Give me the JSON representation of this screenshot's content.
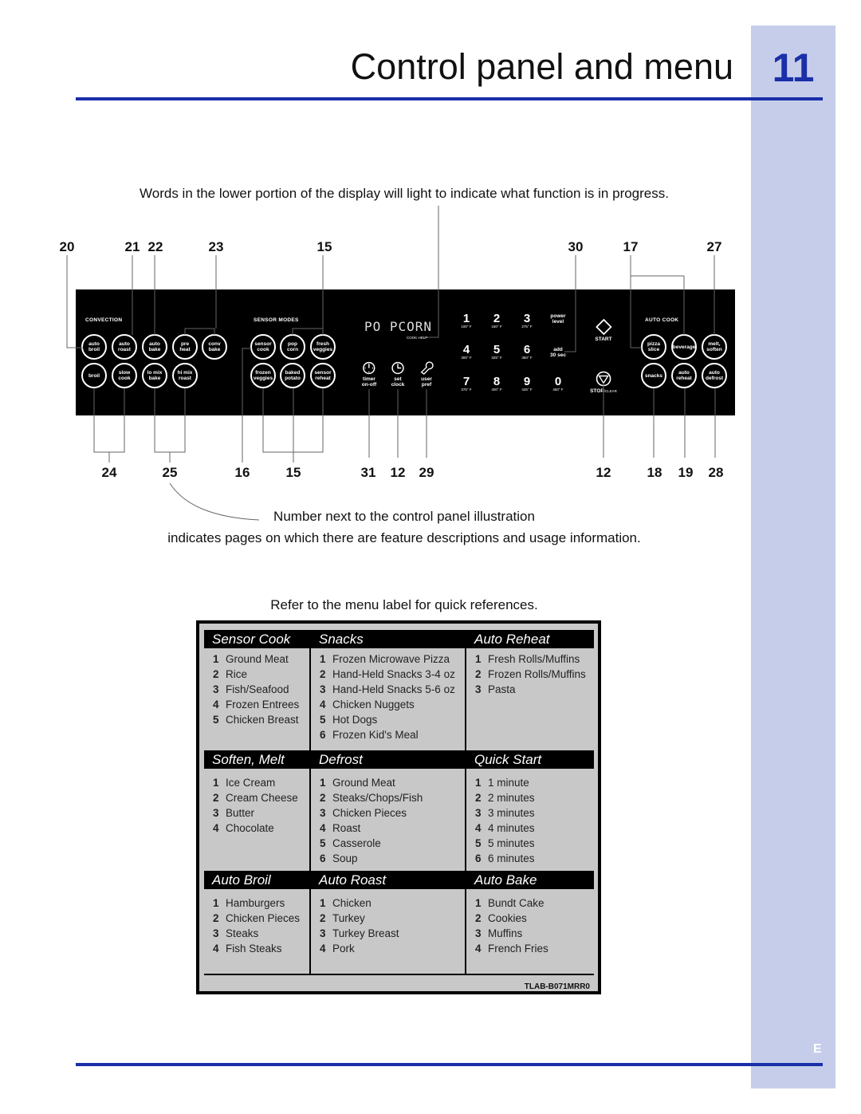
{
  "header": {
    "title": "Control panel and menu",
    "page_number": "11",
    "language_tab": "E"
  },
  "captions": {
    "display_note": "Words in the lower portion of the display will light to indicate what function is in progress.",
    "number_note_1": "Number next to the control panel illustration",
    "number_note_2": "indicates pages on which there are feature descriptions and usage information.",
    "menu_note": "Refer to the menu label for quick references."
  },
  "callouts_top": [
    "20",
    "21",
    "22",
    "23",
    "15",
    "30",
    "17",
    "27"
  ],
  "callouts_bottom": [
    "24",
    "25",
    "16",
    "15",
    "31",
    "12",
    "29",
    "12",
    "18",
    "19",
    "28"
  ],
  "panel": {
    "groups": {
      "convection": "CONVECTION",
      "sensor": "SENSOR MODES",
      "autocook": "AUTO COOK"
    },
    "buttons": [
      "auto\nbroil",
      "auto\nroast",
      "auto\nbake",
      "pre\nheat",
      "conv\nbake",
      "broil",
      "slow\ncook",
      "lo mix\nbake",
      "hi mix\nroast",
      "sensor\ncook",
      "pop\ncorn",
      "fresh\nveggies",
      "frozen\nveggies",
      "baked\npotato",
      "sensor\nreheat",
      "pizza\nslice",
      "beverage",
      "melt,\nsoften",
      "snacks",
      "auto\nreheat",
      "auto\ndefrost"
    ],
    "display_text": "PO PCORN",
    "display_sub": "COOK HELP",
    "functions": [
      {
        "label": "timer\non-off",
        "icon": "timer-icon"
      },
      {
        "label": "set\nclock",
        "icon": "clock-icon"
      },
      {
        "label": "user\npref",
        "icon": "wrench-icon"
      }
    ],
    "keys": [
      {
        "n": "1",
        "t": "100° F"
      },
      {
        "n": "2",
        "t": "150° F"
      },
      {
        "n": "3",
        "t": "275° F"
      },
      {
        "n": "4",
        "t": "300° F"
      },
      {
        "n": "5",
        "t": "325° F"
      },
      {
        "n": "6",
        "t": "350° F"
      },
      {
        "n": "7",
        "t": "375° F"
      },
      {
        "n": "8",
        "t": "400° F"
      },
      {
        "n": "9",
        "t": "425° F"
      },
      {
        "n": "0",
        "t": "450° F"
      }
    ],
    "power_level": "power\nlevel",
    "add30": "add\n30 sec",
    "start": "START",
    "stop": "STOP",
    "clear": "/CLEAR"
  },
  "menu": {
    "sections": [
      {
        "title": "Sensor Cook",
        "items": [
          "Ground Meat",
          "Rice",
          "Fish/Seafood",
          "Frozen Entrees",
          "Chicken Breast"
        ]
      },
      {
        "title": "Snacks",
        "items": [
          "Frozen Microwave Pizza",
          "Hand-Held Snacks 3-4 oz",
          "Hand-Held Snacks 5-6 oz",
          "Chicken Nuggets",
          "Hot Dogs",
          "Frozen Kid's Meal"
        ]
      },
      {
        "title": "Auto Reheat",
        "items": [
          "Fresh Rolls/Muffins",
          "Frozen Rolls/Muffins",
          "Pasta"
        ]
      },
      {
        "title": "Soften, Melt",
        "items": [
          "Ice Cream",
          "Cream Cheese",
          "Butter",
          "Chocolate"
        ]
      },
      {
        "title": "Defrost",
        "items": [
          "Ground Meat",
          "Steaks/Chops/Fish",
          "Chicken Pieces",
          "Roast",
          "Casserole",
          "Soup"
        ]
      },
      {
        "title": "Quick Start",
        "items": [
          "1 minute",
          "2 minutes",
          "3 minutes",
          "4 minutes",
          "5 minutes",
          "6 minutes"
        ]
      },
      {
        "title": "Auto Broil",
        "items": [
          "Hamburgers",
          "Chicken Pieces",
          "Steaks",
          "Fish Steaks"
        ]
      },
      {
        "title": "Auto Roast",
        "items": [
          "Chicken",
          "Turkey",
          "Turkey Breast",
          "Pork"
        ]
      },
      {
        "title": "Auto Bake",
        "items": [
          "Bundt Cake",
          "Cookies",
          "Muffins",
          "French Fries"
        ]
      }
    ],
    "label_code": "TLAB-B071MRR0"
  },
  "colors": {
    "accent": "#1a2fa8",
    "sidebar": "#c6cdeb",
    "menu_bg": "#c8c8c8"
  }
}
